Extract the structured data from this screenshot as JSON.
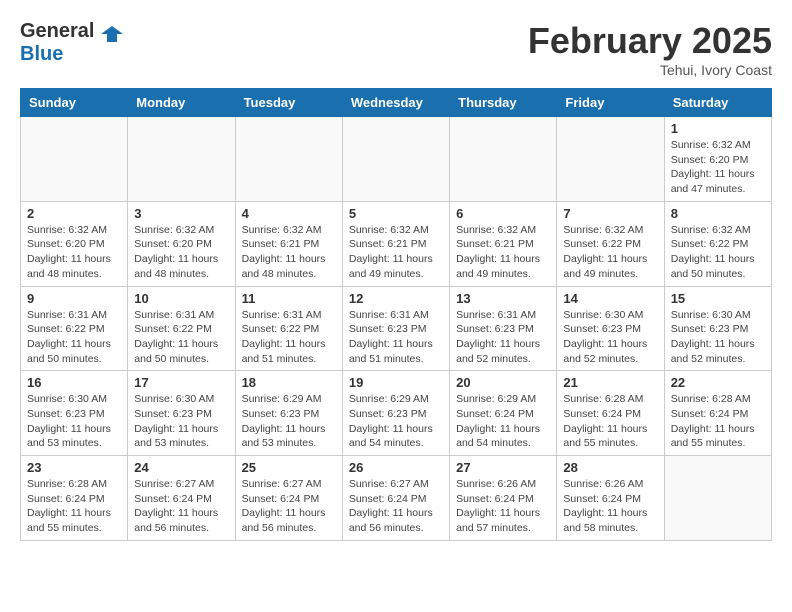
{
  "header": {
    "logo_general": "General",
    "logo_blue": "Blue",
    "month_title": "February 2025",
    "subtitle": "Tehui, Ivory Coast"
  },
  "days_of_week": [
    "Sunday",
    "Monday",
    "Tuesday",
    "Wednesday",
    "Thursday",
    "Friday",
    "Saturday"
  ],
  "weeks": [
    [
      {
        "day": "",
        "info": ""
      },
      {
        "day": "",
        "info": ""
      },
      {
        "day": "",
        "info": ""
      },
      {
        "day": "",
        "info": ""
      },
      {
        "day": "",
        "info": ""
      },
      {
        "day": "",
        "info": ""
      },
      {
        "day": "1",
        "info": "Sunrise: 6:32 AM\nSunset: 6:20 PM\nDaylight: 11 hours and 47 minutes."
      }
    ],
    [
      {
        "day": "2",
        "info": "Sunrise: 6:32 AM\nSunset: 6:20 PM\nDaylight: 11 hours and 48 minutes."
      },
      {
        "day": "3",
        "info": "Sunrise: 6:32 AM\nSunset: 6:20 PM\nDaylight: 11 hours and 48 minutes."
      },
      {
        "day": "4",
        "info": "Sunrise: 6:32 AM\nSunset: 6:21 PM\nDaylight: 11 hours and 48 minutes."
      },
      {
        "day": "5",
        "info": "Sunrise: 6:32 AM\nSunset: 6:21 PM\nDaylight: 11 hours and 49 minutes."
      },
      {
        "day": "6",
        "info": "Sunrise: 6:32 AM\nSunset: 6:21 PM\nDaylight: 11 hours and 49 minutes."
      },
      {
        "day": "7",
        "info": "Sunrise: 6:32 AM\nSunset: 6:22 PM\nDaylight: 11 hours and 49 minutes."
      },
      {
        "day": "8",
        "info": "Sunrise: 6:32 AM\nSunset: 6:22 PM\nDaylight: 11 hours and 50 minutes."
      }
    ],
    [
      {
        "day": "9",
        "info": "Sunrise: 6:31 AM\nSunset: 6:22 PM\nDaylight: 11 hours and 50 minutes."
      },
      {
        "day": "10",
        "info": "Sunrise: 6:31 AM\nSunset: 6:22 PM\nDaylight: 11 hours and 50 minutes."
      },
      {
        "day": "11",
        "info": "Sunrise: 6:31 AM\nSunset: 6:22 PM\nDaylight: 11 hours and 51 minutes."
      },
      {
        "day": "12",
        "info": "Sunrise: 6:31 AM\nSunset: 6:23 PM\nDaylight: 11 hours and 51 minutes."
      },
      {
        "day": "13",
        "info": "Sunrise: 6:31 AM\nSunset: 6:23 PM\nDaylight: 11 hours and 52 minutes."
      },
      {
        "day": "14",
        "info": "Sunrise: 6:30 AM\nSunset: 6:23 PM\nDaylight: 11 hours and 52 minutes."
      },
      {
        "day": "15",
        "info": "Sunrise: 6:30 AM\nSunset: 6:23 PM\nDaylight: 11 hours and 52 minutes."
      }
    ],
    [
      {
        "day": "16",
        "info": "Sunrise: 6:30 AM\nSunset: 6:23 PM\nDaylight: 11 hours and 53 minutes."
      },
      {
        "day": "17",
        "info": "Sunrise: 6:30 AM\nSunset: 6:23 PM\nDaylight: 11 hours and 53 minutes."
      },
      {
        "day": "18",
        "info": "Sunrise: 6:29 AM\nSunset: 6:23 PM\nDaylight: 11 hours and 53 minutes."
      },
      {
        "day": "19",
        "info": "Sunrise: 6:29 AM\nSunset: 6:23 PM\nDaylight: 11 hours and 54 minutes."
      },
      {
        "day": "20",
        "info": "Sunrise: 6:29 AM\nSunset: 6:24 PM\nDaylight: 11 hours and 54 minutes."
      },
      {
        "day": "21",
        "info": "Sunrise: 6:28 AM\nSunset: 6:24 PM\nDaylight: 11 hours and 55 minutes."
      },
      {
        "day": "22",
        "info": "Sunrise: 6:28 AM\nSunset: 6:24 PM\nDaylight: 11 hours and 55 minutes."
      }
    ],
    [
      {
        "day": "23",
        "info": "Sunrise: 6:28 AM\nSunset: 6:24 PM\nDaylight: 11 hours and 55 minutes."
      },
      {
        "day": "24",
        "info": "Sunrise: 6:27 AM\nSunset: 6:24 PM\nDaylight: 11 hours and 56 minutes."
      },
      {
        "day": "25",
        "info": "Sunrise: 6:27 AM\nSunset: 6:24 PM\nDaylight: 11 hours and 56 minutes."
      },
      {
        "day": "26",
        "info": "Sunrise: 6:27 AM\nSunset: 6:24 PM\nDaylight: 11 hours and 56 minutes."
      },
      {
        "day": "27",
        "info": "Sunrise: 6:26 AM\nSunset: 6:24 PM\nDaylight: 11 hours and 57 minutes."
      },
      {
        "day": "28",
        "info": "Sunrise: 6:26 AM\nSunset: 6:24 PM\nDaylight: 11 hours and 58 minutes."
      },
      {
        "day": "",
        "info": ""
      }
    ]
  ]
}
